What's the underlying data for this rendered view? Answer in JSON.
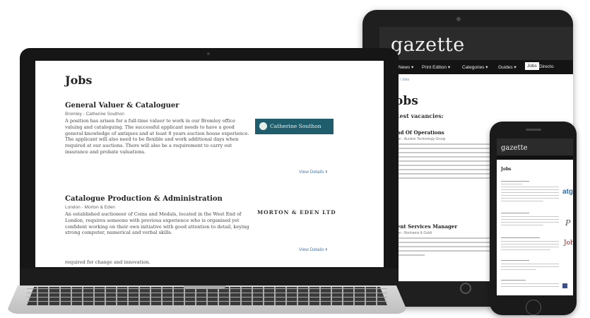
{
  "tablet": {
    "logo": "gazette",
    "logo_sub": "",
    "nav": [
      "⌂",
      "News ▾",
      "Print Edition ▾",
      "Categories ▾",
      "Guides ▾",
      "Jobs",
      "Directo"
    ],
    "breadcrumb": "Home / Jobs",
    "title": "Jobs",
    "latest": "Latest vacancies:",
    "jobs": [
      {
        "title": "Head Of Operations",
        "meta": "London - Auction Technology Group"
      },
      {
        "title": "Client Services Manager",
        "meta": "London - Bonhams & Goldi"
      }
    ]
  },
  "laptop": {
    "title": "Jobs",
    "jobs": [
      {
        "title": "General Valuer & Cataloguer",
        "meta": "Bromley - Catherine Southon",
        "desc": "A position has arisen for a full-time valuer to work in our Bromley office valuing and cataloguing. The successful applicant needs to have a good general knowledge of antiques and at least 8 years auction house experience. The applicant will also need to be flexible and work additional days when required at our auctions. There will also be a requirement to carry out insurance and probate valuations.",
        "logo": "Catherine Southon",
        "link": "View Details"
      },
      {
        "title": "Catalogue Production & Administration",
        "meta": "London - Morton & Eden",
        "desc": "An established auctioneer of Coins and Medals, located in the West End of London, requires someone with previous experience who is organised yet confident working on their own initiative with good attention to detail, keying strong computer, numerical and verbal skills.",
        "logo": "MORTON & EDEN LTD",
        "link": "View Details"
      }
    ],
    "bottom_text": "required for change and innovation."
  },
  "phone": {
    "logo": "gazette",
    "title": "Jobs",
    "logos": [
      "atg",
      "P",
      "John"
    ]
  }
}
